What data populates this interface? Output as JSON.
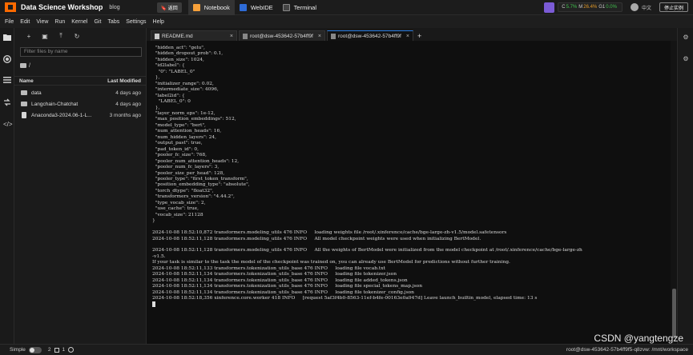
{
  "topbar": {
    "app_title": "Data Science Workshop",
    "project": "blog",
    "lab_chip": "🔖 返回",
    "main_tabs": [
      "Notebook",
      "WebIDE",
      "Terminal"
    ],
    "resources": {
      "c_label": "C",
      "c_value": "5.7%",
      "m_label": "M",
      "m_value": "26.4%",
      "g_label": "G1",
      "g_value": "0.0%"
    },
    "language": "中文",
    "stop_button": "停止实例"
  },
  "menu": [
    "File",
    "Edit",
    "View",
    "Run",
    "Kernel",
    "Git",
    "Tabs",
    "Settings",
    "Help"
  ],
  "filebrowser": {
    "filter_placeholder": "Filter files by name",
    "breadcrumb": "/",
    "col_name": "Name",
    "col_modified": "Last Modified",
    "rows": [
      {
        "name": "data",
        "modified": "4 days ago",
        "type": "folder"
      },
      {
        "name": "Langchain-Chatchat",
        "modified": "4 days ago",
        "type": "folder"
      },
      {
        "name": "Anaconda3-2024.06-1-L...",
        "modified": "3 months ago",
        "type": "file"
      }
    ]
  },
  "doc_tabs": [
    {
      "label": "README.md",
      "active": false
    },
    {
      "label": "root@dsw-453642-57b4ff9f",
      "active": false
    },
    {
      "label": "root@dsw-453642-57b4ff9f",
      "active": true
    }
  ],
  "terminal_lines": [
    "  \"hidden_act\": \"gelu\",",
    "  \"hidden_dropout_prob\": 0.1,",
    "  \"hidden_size\": 1024,",
    "  \"id2label\": {",
    "    \"0\": \"LABEL_0\"",
    "  },",
    "  \"initializer_range\": 0.02,",
    "  \"intermediate_size\": 4096,",
    "  \"label2id\": {",
    "    \"LABEL_0\": 0",
    "  },",
    "  \"layer_norm_eps\": 1e-12,",
    "  \"max_position_embeddings\": 512,",
    "  \"model_type\": \"bert\",",
    "  \"num_attention_heads\": 16,",
    "  \"num_hidden_layers\": 24,",
    "  \"output_past\": true,",
    "  \"pad_token_id\": 0,",
    "  \"pooler_fc_size\": 768,",
    "  \"pooler_num_attention_heads\": 12,",
    "  \"pooler_num_fc_layers\": 3,",
    "  \"pooler_size_per_head\": 128,",
    "  \"pooler_type\": \"first_token_transform\",",
    "  \"position_embedding_type\": \"absolute\",",
    "  \"torch_dtype\": \"float32\",",
    "  \"transformers_version\": \"4.44.2\",",
    "  \"type_vocab_size\": 2,",
    "  \"use_cache\": true,",
    "  \"vocab_size\": 21128",
    "}",
    "",
    "2024-10-08 18:52:10,872 transformers.modeling_utils 476 INFO     loading weights file /root/.xinference/cache/bge-large-zh-v1.5/model.safetensors",
    "2024-10-08 18:52:11,128 transformers.modeling_utils 476 INFO     All model checkpoint weights were used when initializing BertModel.",
    "",
    "2024-10-08 18:52:11,128 transformers.modeling_utils 476 INFO     All the weights of BertModel were initialized from the model checkpoint at /root/.xinference/cache/bge-large-zh",
    "-v1.5.",
    "If your task is similar to the task the model of the checkpoint was trained on, you can already use BertModel for predictions without further training.",
    "2024-10-08 18:52:11,133 transformers.tokenization_utils_base 476 INFO     loading file vocab.txt",
    "2024-10-08 18:52:11,134 transformers.tokenization_utils_base 476 INFO     loading file tokenizer.json",
    "2024-10-08 18:52:11,134 transformers.tokenization_utils_base 476 INFO     loading file added_tokens.json",
    "2024-10-08 18:52:11,134 transformers.tokenization_utils_base 476 INFO     loading file special_tokens_map.json",
    "2024-10-08 18:52:11,134 transformers.tokenization_utils_base 476 INFO     loading file tokenizer_config.json",
    "2024-10-08 18:52:18,356 xinference.core.worker 418 INFO     [request 5af3f4b0-8563-11ef-b4fe-00163e0a947d] Leave launch_builtin_model, elapsed time: 13 s"
  ],
  "statusbar": {
    "mode": "Simple",
    "count_a": "2",
    "count_b": "1",
    "right_text": "root@dsw-453642-57b4ff9f5-q8zvw: /mnt/workspace"
  },
  "watermark": "CSDN @yangtengze",
  "colors": {
    "accent": "#2a7de1",
    "brand": "#ff6a00",
    "purple": "#7b5bd6"
  }
}
